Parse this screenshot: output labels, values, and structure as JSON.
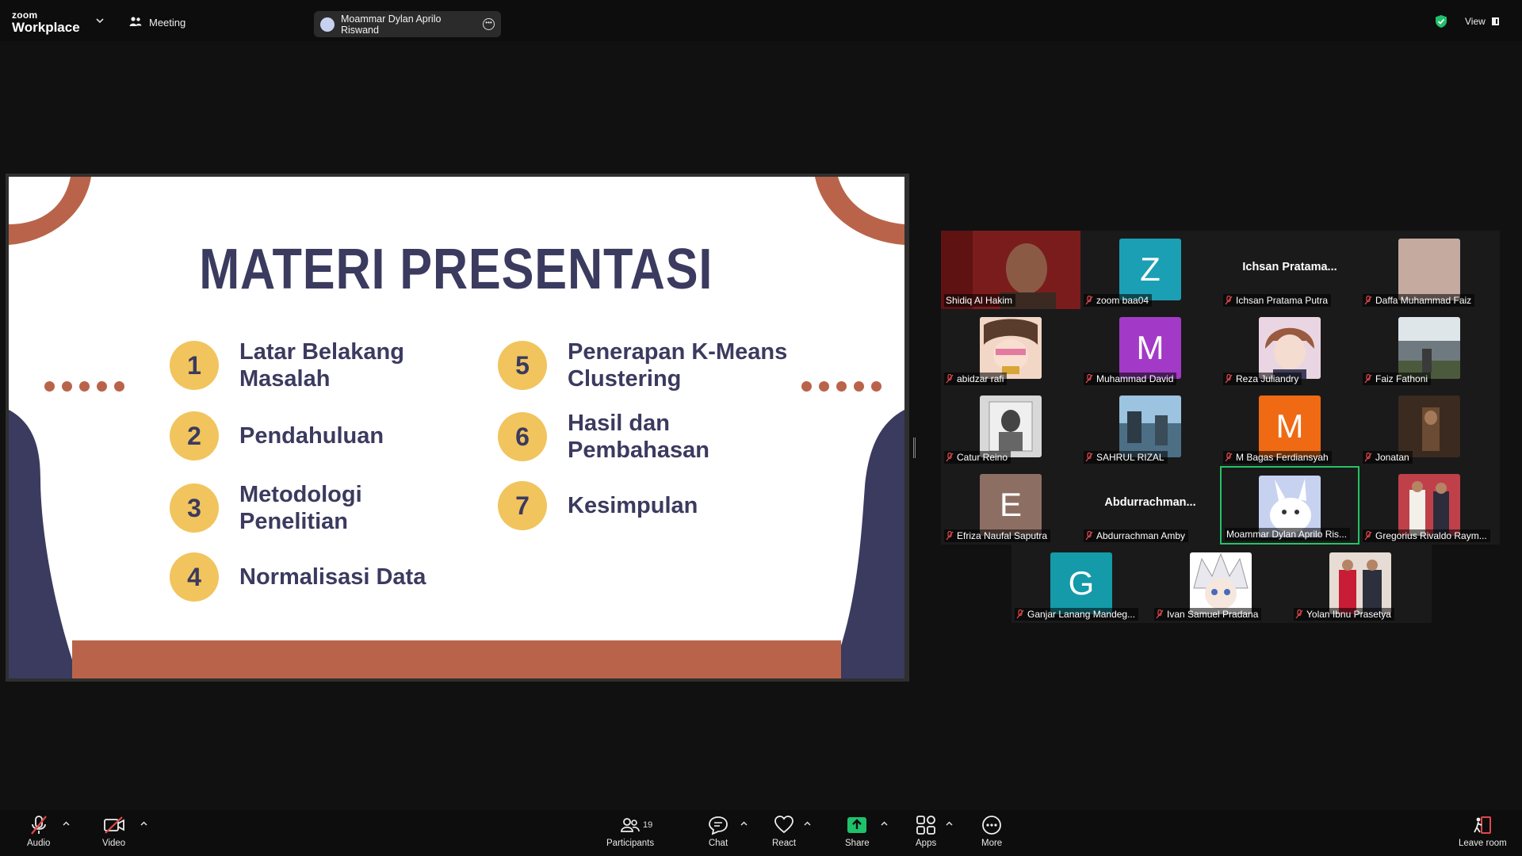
{
  "topbar": {
    "brand_small": "zoom",
    "brand_large": "Workplace",
    "meeting_label": "Meeting",
    "active_speaker": "Moammar Dylan Aprilo Riswand",
    "view_label": "View"
  },
  "slide": {
    "title": "MATERI PRESENTASI",
    "items": [
      {
        "num": "1",
        "text": "Latar Belakang Masalah"
      },
      {
        "num": "2",
        "text": "Pendahuluan"
      },
      {
        "num": "3",
        "text": "Metodologi Penelitian"
      },
      {
        "num": "4",
        "text": "Normalisasi Data"
      },
      {
        "num": "5",
        "text": "Penerapan K-Means Clustering"
      },
      {
        "num": "6",
        "text": "Hasil dan Pembahasan"
      },
      {
        "num": "7",
        "text": "Kesimpulan"
      }
    ]
  },
  "participants": [
    {
      "name": "Shidiq Al Hakim"
    },
    {
      "name": "zoom baa04",
      "letter": "Z"
    },
    {
      "name": "Ichsan Pratama Putra",
      "display": "Ichsan  Pratama..."
    },
    {
      "name": "Daffa Muhammad Faiz"
    },
    {
      "name": "abidzar rafi"
    },
    {
      "name": "Muhammad David",
      "letter": "M"
    },
    {
      "name": "Reza Juliandry"
    },
    {
      "name": "Faiz Fathoni"
    },
    {
      "name": "Catur Reino"
    },
    {
      "name": "SAHRUL RIZAL"
    },
    {
      "name": "M Bagas Ferdiansyah",
      "letter": "M"
    },
    {
      "name": "Jonatan"
    },
    {
      "name": "Efriza Naufal Saputra",
      "letter": "E"
    },
    {
      "name": "Abdurrachman Amby",
      "display": "Abdurrachman..."
    },
    {
      "name": "Moammar Dylan Aprilo Ris..."
    },
    {
      "name": "Gregorius Rivaldo Raym..."
    },
    {
      "name": "Ganjar Lanang Mandeg...",
      "letter": "G"
    },
    {
      "name": "Ivan Samuel Pradana"
    },
    {
      "name": "Yolan Ibnu Prasetya"
    }
  ],
  "toolbar": {
    "audio": "Audio",
    "video": "Video",
    "participants": "Participants",
    "participant_count": "19",
    "chat": "Chat",
    "react": "React",
    "share": "Share",
    "apps": "Apps",
    "more": "More",
    "leave": "Leave room"
  },
  "colors": {
    "slide_navy": "#3b3a5f",
    "slide_terracotta": "#b9644a",
    "slide_yellow": "#f1c45d",
    "active_speaker_border": "#24c466",
    "share_green": "#1fc16b",
    "muted_red": "#e0484b"
  }
}
